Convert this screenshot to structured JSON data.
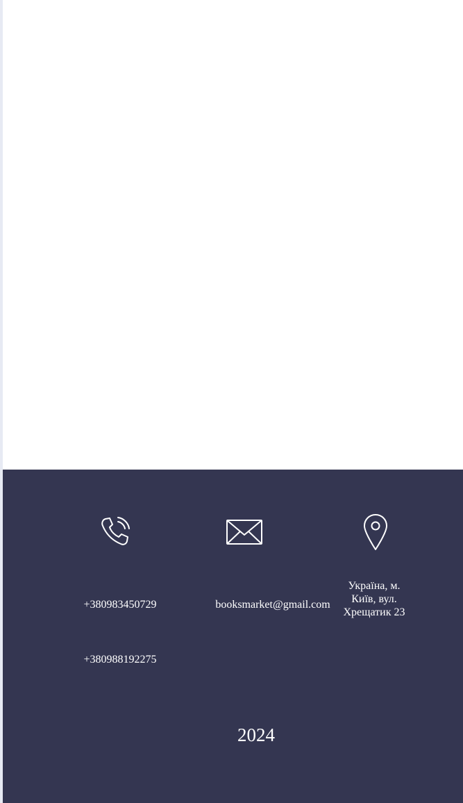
{
  "footer": {
    "phones": [
      "+380983450729",
      "+380988192275"
    ],
    "email": "booksmarket@gmail.com",
    "address": "Україна, м. Київ, вул. Хрещатик 23",
    "year": "2024",
    "icons": {
      "phone": "phone-icon",
      "email": "envelope-icon",
      "location": "map-pin-icon"
    }
  },
  "colors": {
    "footer_bg": "#343651",
    "footer_text": "#ffffff",
    "page_bg": "#ffffff",
    "left_strip": "#e7eaf3"
  }
}
